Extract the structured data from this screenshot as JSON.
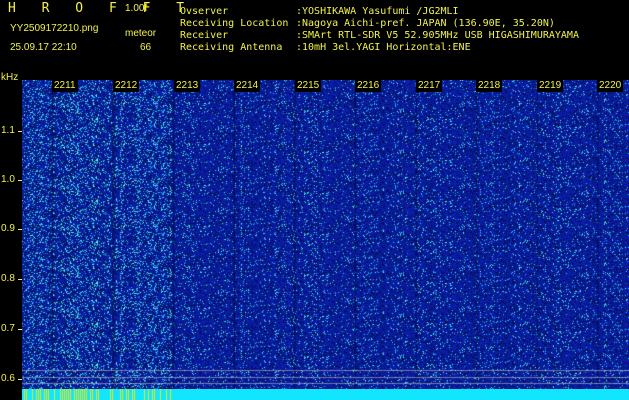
{
  "header": {
    "app_name": "H R O F F T",
    "version": "1.00f",
    "filename": "YY2509172210.png",
    "timestamp": "25.09.17 22:10",
    "mode_label": "meteor",
    "count": "66"
  },
  "meta": [
    {
      "key": "Ovserver",
      "value": ":YOSHIKAWA Yasufumi /JG2MLI"
    },
    {
      "key": "Receiving Location",
      "value": ":Nagoya Aichi-pref. JAPAN (136.90E, 35.20N)"
    },
    {
      "key": "Receiver",
      "value": ":SMArt RTL-SDR V5 52.905MHz USB HIGASHIMURAYAMA"
    },
    {
      "key": "Receiving Antenna",
      "value": ":10mH 3el.YAGI Horizontal:ENE"
    }
  ],
  "y_axis": {
    "unit": "kHz",
    "ticks": [
      "1.1",
      "1.0",
      "0.9",
      "0.8",
      "0.7",
      "0.6"
    ]
  },
  "time_axis": [
    "2211",
    "2212",
    "2213",
    "2214",
    "2215",
    "2216",
    "2217",
    "2218",
    "2219",
    "2220"
  ],
  "colors": {
    "text": "#f2f24a",
    "background": "#000000",
    "spectrogram_base": "#0b1f9e",
    "bottom_strip": "#12e6ff"
  }
}
